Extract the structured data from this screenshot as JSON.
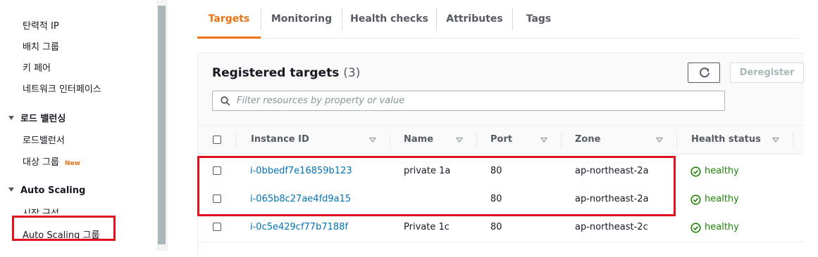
{
  "sidebar": {
    "items": [
      {
        "label": "탄력적 IP"
      },
      {
        "label": "배치 그룹"
      },
      {
        "label": "키 페어"
      },
      {
        "label": "네트워크 인터페이스"
      }
    ],
    "load_balancing": {
      "heading": "로드 밸런싱",
      "items": [
        {
          "label": "로드밸런서"
        },
        {
          "label": "대상 그룹",
          "badge": "New"
        }
      ]
    },
    "auto_scaling": {
      "heading": "Auto Scaling",
      "items": [
        {
          "label": "시작 구성"
        },
        {
          "label": "Auto Scaling 그룹"
        }
      ]
    }
  },
  "tabs": [
    {
      "label": "Targets",
      "active": true
    },
    {
      "label": "Monitoring"
    },
    {
      "label": "Health checks"
    },
    {
      "label": "Attributes"
    },
    {
      "label": "Tags"
    }
  ],
  "panel": {
    "title": "Registered targets",
    "count": "(3)",
    "refresh_icon": "refresh-icon",
    "deregister_label": "Deregister",
    "search_placeholder": "Filter resources by property or value"
  },
  "table": {
    "columns": [
      "Instance ID",
      "Name",
      "Port",
      "Zone",
      "Health status"
    ],
    "rows": [
      {
        "instance_id": "i-0bbedf7e16859b123",
        "name": "private 1a",
        "port": "80",
        "zone": "ap-northeast-2a",
        "health": "healthy"
      },
      {
        "instance_id": "i-065b8c27ae4fd9a15",
        "name": "",
        "port": "80",
        "zone": "ap-northeast-2a",
        "health": "healthy"
      },
      {
        "instance_id": "i-0c5e429cf77b7188f",
        "name": "Private 1c",
        "port": "80",
        "zone": "ap-northeast-2c",
        "health": "healthy"
      }
    ]
  },
  "colors": {
    "accent": "#ec7211",
    "link": "#0073bb",
    "healthy": "#1d8102",
    "highlight_box": "#e0101c"
  }
}
